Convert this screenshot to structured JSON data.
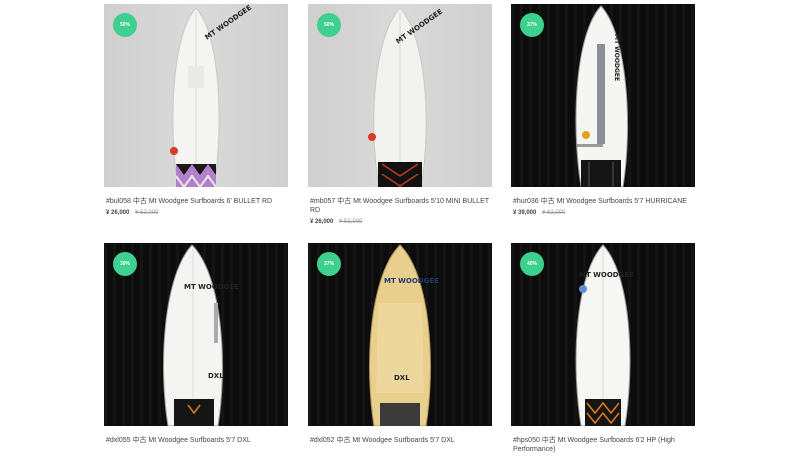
{
  "products": [
    {
      "badge": "50%",
      "title": "#bul058 中古 Mt Woodgee Surfboards 6' BULLET RD",
      "price": "¥ 26,000",
      "original_price": "¥ 52,000"
    },
    {
      "badge": "50%",
      "title": "#mb057 中古 Mt Woodgee Surfboards 5'10 MINI BULLET RD",
      "price": "¥ 26,000",
      "original_price": "¥ 52,000"
    },
    {
      "badge": "37%",
      "title": "#hur036 中古 Mt Woodgee Surfboards 5'7 HURRICANE",
      "price": "¥ 39,000",
      "original_price": "¥ 62,000"
    },
    {
      "badge": "39%",
      "title": "#dxl055 中古 Mt Woodgee Surfboards 5'7 DXL",
      "price": "",
      "original_price": ""
    },
    {
      "badge": "37%",
      "title": "#dxl052 中古 Mt Woodgee Surfboards 5'7 DXL",
      "price": "",
      "original_price": ""
    },
    {
      "badge": "40%",
      "title": "#hps050 中古 Mt Woodgee Surfboards 6'2 HP (High Performance)",
      "price": "",
      "original_price": ""
    }
  ],
  "brand_text": "MT WOODGEE",
  "colors": {
    "badge": "#3ed08f",
    "light_bg": "#d4d4d4",
    "dark_bg": "#0c0c0c"
  }
}
